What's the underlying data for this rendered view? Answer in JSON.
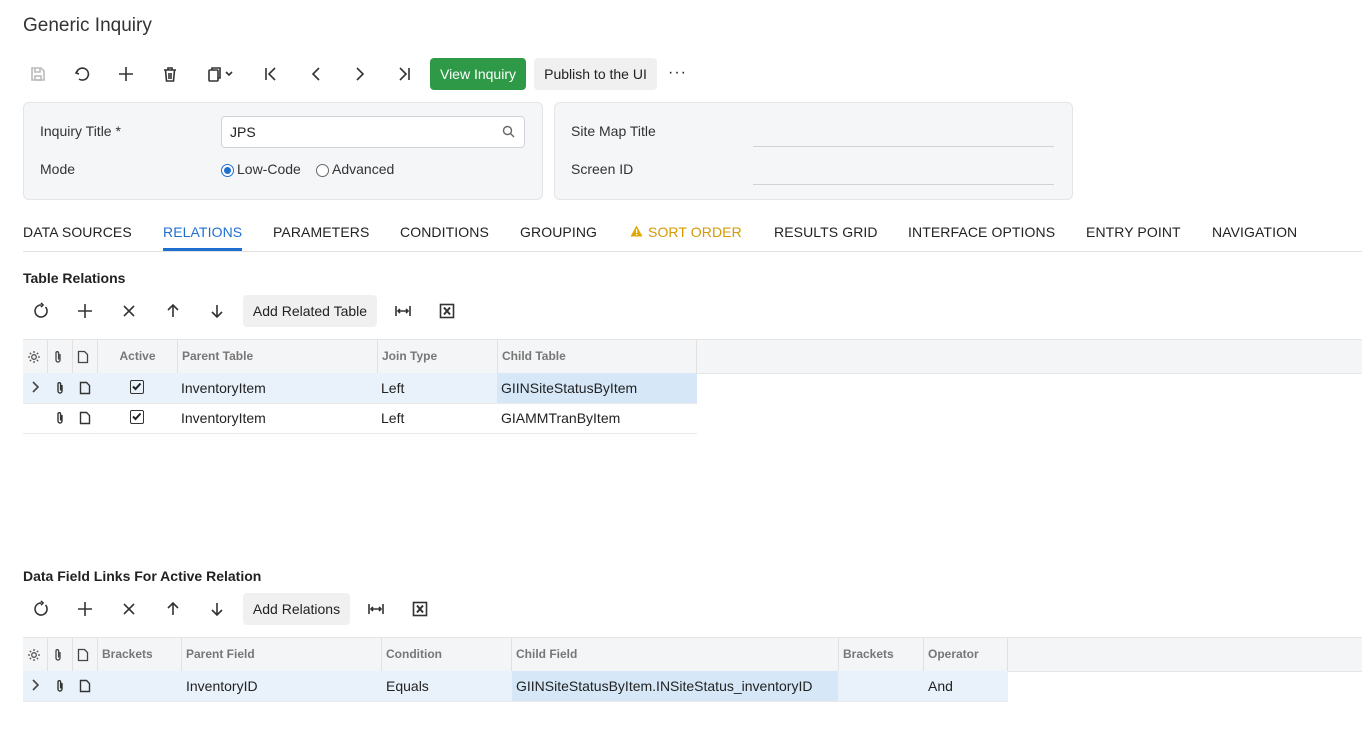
{
  "page": {
    "title": "Generic Inquiry"
  },
  "toolbar": {
    "view_inquiry": "View Inquiry",
    "publish": "Publish to the UI",
    "more": "···"
  },
  "form": {
    "inquiry_title_label": "Inquiry Title *",
    "inquiry_title_value": "JPS",
    "mode_label": "Mode",
    "mode_options": [
      "Low-Code",
      "Advanced"
    ],
    "mode_selected": "Low-Code",
    "site_map_title_label": "Site Map Title",
    "site_map_title_value": "",
    "screen_id_label": "Screen ID",
    "screen_id_value": ""
  },
  "tabs": [
    {
      "label": "DATA SOURCES"
    },
    {
      "label": "RELATIONS",
      "active": true
    },
    {
      "label": "PARAMETERS"
    },
    {
      "label": "CONDITIONS"
    },
    {
      "label": "GROUPING"
    },
    {
      "label": "SORT ORDER",
      "warning": true
    },
    {
      "label": "RESULTS GRID"
    },
    {
      "label": "INTERFACE OPTIONS"
    },
    {
      "label": "ENTRY POINT"
    },
    {
      "label": "NAVIGATION"
    }
  ],
  "table_relations": {
    "title": "Table Relations",
    "add_button": "Add Related Table",
    "columns": [
      "Active",
      "Parent Table",
      "Join Type",
      "Child Table"
    ],
    "rows": [
      {
        "active": true,
        "parent": "InventoryItem",
        "join": "Left",
        "child": "GIINSiteStatusByItem"
      },
      {
        "active": true,
        "parent": "InventoryItem",
        "join": "Left",
        "child": "GIAMMTranByItem"
      }
    ]
  },
  "field_links": {
    "title": "Data Field Links For Active Relation",
    "add_button": "Add Relations",
    "columns": [
      "Brackets",
      "Parent Field",
      "Condition",
      "Child Field",
      "Brackets",
      "Operator"
    ],
    "rows": [
      {
        "brackets_open": "",
        "parent": "InventoryID",
        "condition": "Equals",
        "child": "GIINSiteStatusByItem.INSiteStatus_inventoryID",
        "brackets_close": "",
        "operator": "And"
      }
    ]
  },
  "colors": {
    "accent": "#1f6fd1",
    "green": "#2e9a47",
    "warning": "#d49a00"
  }
}
